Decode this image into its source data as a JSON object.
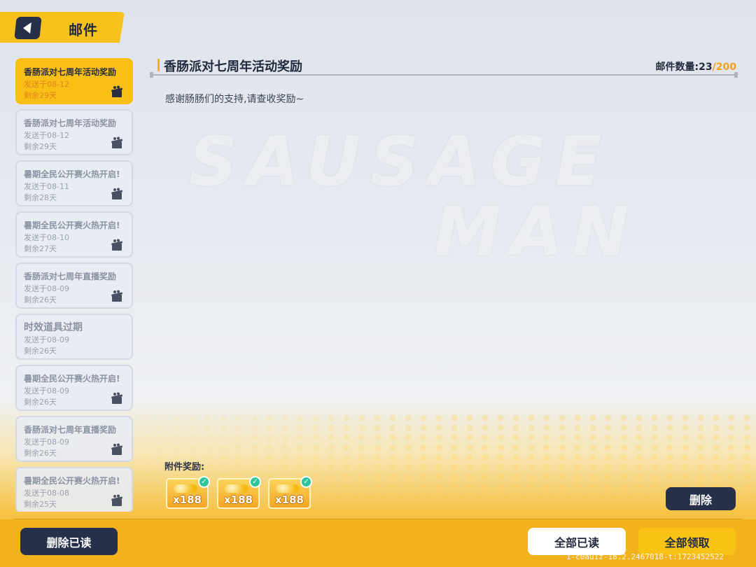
{
  "header": {
    "title": "邮件",
    "back_icon": "back-arrow-icon"
  },
  "watermark": {
    "line1": "SAUSAGE",
    "line2": "MAN"
  },
  "mail_list": [
    {
      "title": "香肠派对七周年活动奖励",
      "date": "发送于08-12",
      "remain": "剩余29天",
      "has_gift": true,
      "selected": true
    },
    {
      "title": "香肠派对七周年活动奖励",
      "date": "发送于08-12",
      "remain": "剩余29天",
      "has_gift": true,
      "selected": false
    },
    {
      "title": "暑期全民公开赛火热开启!",
      "date": "发送于08-11",
      "remain": "剩余28天",
      "has_gift": true,
      "selected": false
    },
    {
      "title": "暑期全民公开赛火热开启!",
      "date": "发送于08-10",
      "remain": "剩余27天",
      "has_gift": true,
      "selected": false
    },
    {
      "title": "香肠派对七周年直播奖励",
      "date": "发送于08-09",
      "remain": "剩余26天",
      "has_gift": true,
      "selected": false
    },
    {
      "title": "时效道具过期",
      "date": "发送于08-09",
      "remain": "剩余26天",
      "has_gift": false,
      "selected": false
    },
    {
      "title": "暑期全民公开赛火热开启!",
      "date": "发送于08-09",
      "remain": "剩余26天",
      "has_gift": true,
      "selected": false
    },
    {
      "title": "香肠派对七周年直播奖励",
      "date": "发送于08-09",
      "remain": "剩余26天",
      "has_gift": true,
      "selected": false
    },
    {
      "title": "暑期全民公开赛火热开启!",
      "date": "发送于08-08",
      "remain": "剩余25天",
      "has_gift": true,
      "selected": false
    }
  ],
  "content": {
    "title": "香肠派对七周年活动奖励",
    "count_label": "邮件数量:",
    "count_current": "23",
    "count_sep": "/",
    "count_max": "200",
    "body": "感谢肠肠们的支持,请查收奖励~",
    "attachments_label": "附件奖励:",
    "attachments": [
      {
        "icon": "gold-coins-icon",
        "qty": "x188",
        "claimed": true
      },
      {
        "icon": "gold-coins-icon",
        "qty": "x188",
        "claimed": true
      },
      {
        "icon": "gold-coins-icon",
        "qty": "x188",
        "claimed": true
      }
    ]
  },
  "buttons": {
    "delete": "删除",
    "delete_read": "删除已读",
    "read_all": "全部已读",
    "claim_all": "全部领取"
  },
  "build_info": "1-c0au1z-18.2.2467018-t:1723452522",
  "colors": {
    "accent": "#f8c315",
    "dark": "#27304a",
    "claimed": "#2fc59a"
  }
}
